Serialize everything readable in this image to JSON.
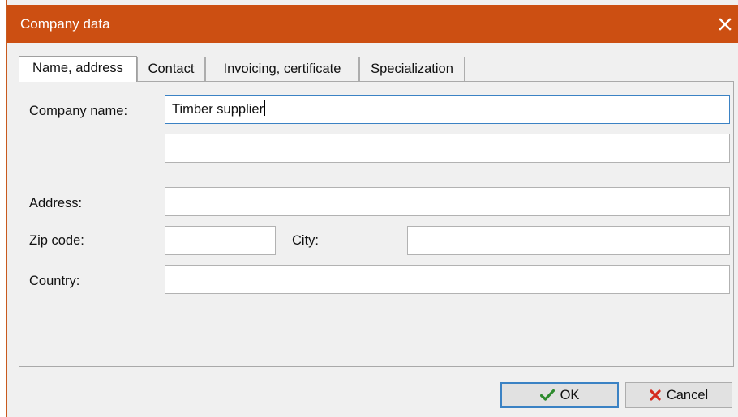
{
  "window": {
    "title": "Company data",
    "accent_color": "#cc4f12",
    "close_icon": "close-icon"
  },
  "tabs": [
    {
      "label": "Name, address",
      "active": true
    },
    {
      "label": "Contact",
      "active": false
    },
    {
      "label": "Invoicing, certificate",
      "active": false
    },
    {
      "label": "Specialization",
      "active": false
    }
  ],
  "form": {
    "company_name_label": "Company name:",
    "company_name_value": "Timber supplier",
    "company_name_line2_value": "",
    "address_label": "Address:",
    "address_value": "",
    "zip_label": "Zip code:",
    "zip_value": "",
    "city_label": "City:",
    "city_value": "",
    "country_label": "Country:",
    "country_value": ""
  },
  "buttons": {
    "ok_label": "OK",
    "ok_icon": "checkmark-icon",
    "ok_icon_color": "#2e8b2e",
    "cancel_label": "Cancel",
    "cancel_icon": "x-icon",
    "cancel_icon_color": "#d42a1e"
  }
}
